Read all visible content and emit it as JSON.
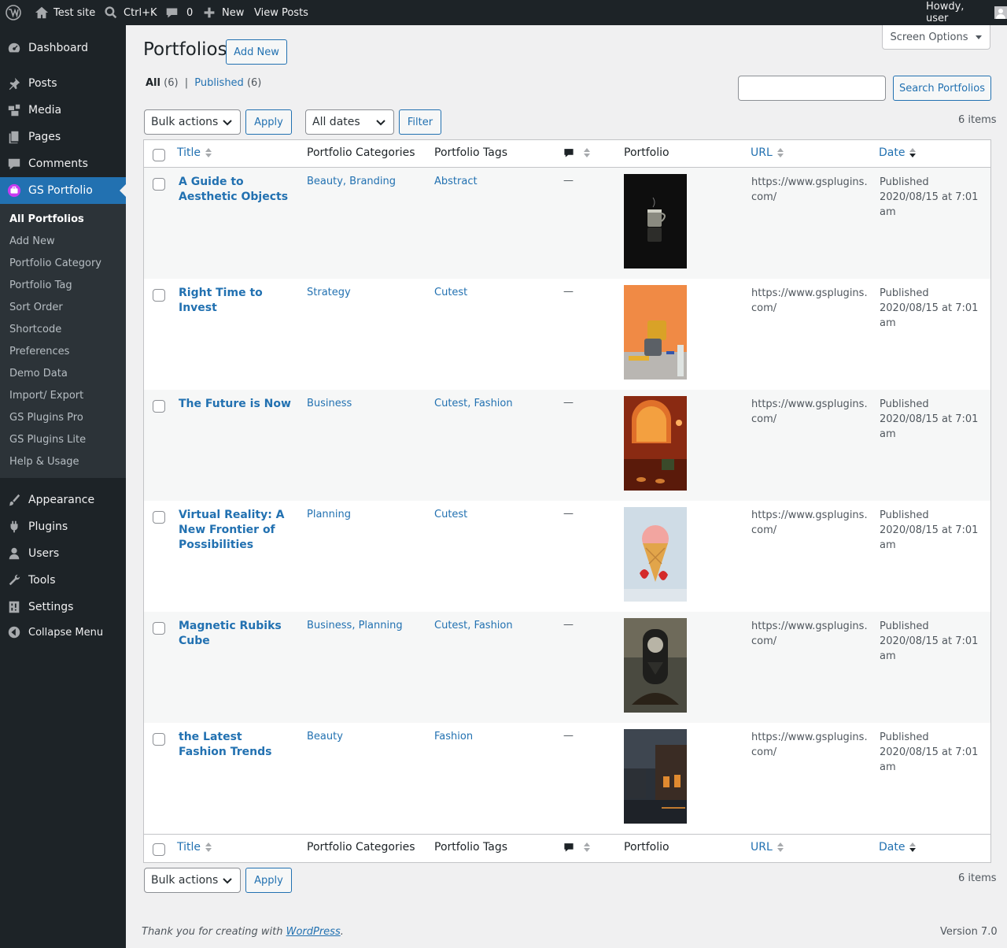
{
  "adminbar": {
    "site": "Test site",
    "search": "Ctrl+K",
    "comments": "0",
    "new": "New",
    "view": "View Posts",
    "howdy": "Howdy, user"
  },
  "menu": {
    "top": [
      {
        "label": "Dashboard",
        "icon": "dashboard-icon"
      },
      {
        "label": "Posts",
        "icon": "pin-icon"
      },
      {
        "label": "Media",
        "icon": "media-icon"
      },
      {
        "label": "Pages",
        "icon": "pages-icon"
      },
      {
        "label": "Comments",
        "icon": "comment-icon"
      },
      {
        "label": "GS Portfolio",
        "icon": "portfolio-icon"
      }
    ],
    "sub": [
      "All Portfolios",
      "Add New",
      "Portfolio Category",
      "Portfolio Tag",
      "Sort Order",
      "Shortcode",
      "Preferences",
      "Demo Data",
      "Import/ Export",
      "GS Plugins Pro",
      "GS Plugins Lite",
      "Help & Usage"
    ],
    "bottom": [
      {
        "label": "Appearance",
        "icon": "brush-icon"
      },
      {
        "label": "Plugins",
        "icon": "plugin-icon"
      },
      {
        "label": "Users",
        "icon": "user-icon"
      },
      {
        "label": "Tools",
        "icon": "wrench-icon"
      },
      {
        "label": "Settings",
        "icon": "settings-icon"
      },
      {
        "label": "Collapse Menu",
        "icon": "collapse-icon"
      }
    ]
  },
  "page": {
    "title": "Portfolios",
    "add_new": "Add New",
    "screen_options": "Screen Options",
    "filter_all": "All",
    "filter_all_count": "(6)",
    "filter_sep": "|",
    "filter_published": "Published",
    "filter_published_count": "(6)",
    "search_button": "Search Portfolios",
    "search_value": "",
    "bulk_actions": "Bulk actions",
    "apply": "Apply",
    "all_dates": "All dates",
    "filter": "Filter",
    "items": "6 items"
  },
  "columns": {
    "title": "Title",
    "categories": "Portfolio Categories",
    "tags": "Portfolio Tags",
    "portfolio": "Portfolio",
    "url": "URL",
    "date": "Date"
  },
  "rows": [
    {
      "title": "A Guide to Aesthetic Objects",
      "categories": "Beauty, Branding",
      "tags": "Abstract",
      "comments": "—",
      "url": "https://www.gsplugins.com/",
      "status": "Published",
      "date": "2020/08/15 at 7:01 am",
      "thumb": "coffee-cup-image"
    },
    {
      "title": "Right Time to Invest",
      "categories": "Strategy",
      "tags": "Cutest",
      "comments": "—",
      "url": "https://www.gsplugins.com/",
      "status": "Published",
      "date": "2020/08/15 at 7:01 am",
      "thumb": "mugs-image"
    },
    {
      "title": "The Future is Now",
      "categories": "Business",
      "tags": "Cutest, Fashion",
      "comments": "—",
      "url": "https://www.gsplugins.com/",
      "status": "Published",
      "date": "2020/08/15 at 7:01 am",
      "thumb": "red-room-image"
    },
    {
      "title": "Virtual Reality: A New Frontier of Possibilities",
      "categories": "Planning",
      "tags": "Cutest",
      "comments": "—",
      "url": "https://www.gsplugins.com/",
      "status": "Published",
      "date": "2020/08/15 at 7:01 am",
      "thumb": "ice-cream-image"
    },
    {
      "title": "Magnetic Rubiks Cube",
      "categories": "Business, Planning",
      "tags": "Cutest, Fashion",
      "comments": "—",
      "url": "https://www.gsplugins.com/",
      "status": "Published",
      "date": "2020/08/15 at 7:01 am",
      "thumb": "hourglass-clock-image"
    },
    {
      "title": "the Latest Fashion Trends",
      "categories": "Beauty",
      "tags": "Fashion",
      "comments": "—",
      "url": "https://www.gsplugins.com/",
      "status": "Published",
      "date": "2020/08/15 at 7:01 am",
      "thumb": "night-street-image"
    }
  ],
  "footer": {
    "thanks": "Thank you for creating with",
    "wp": "WordPress",
    "period": ".",
    "version": "Version 7.0"
  }
}
